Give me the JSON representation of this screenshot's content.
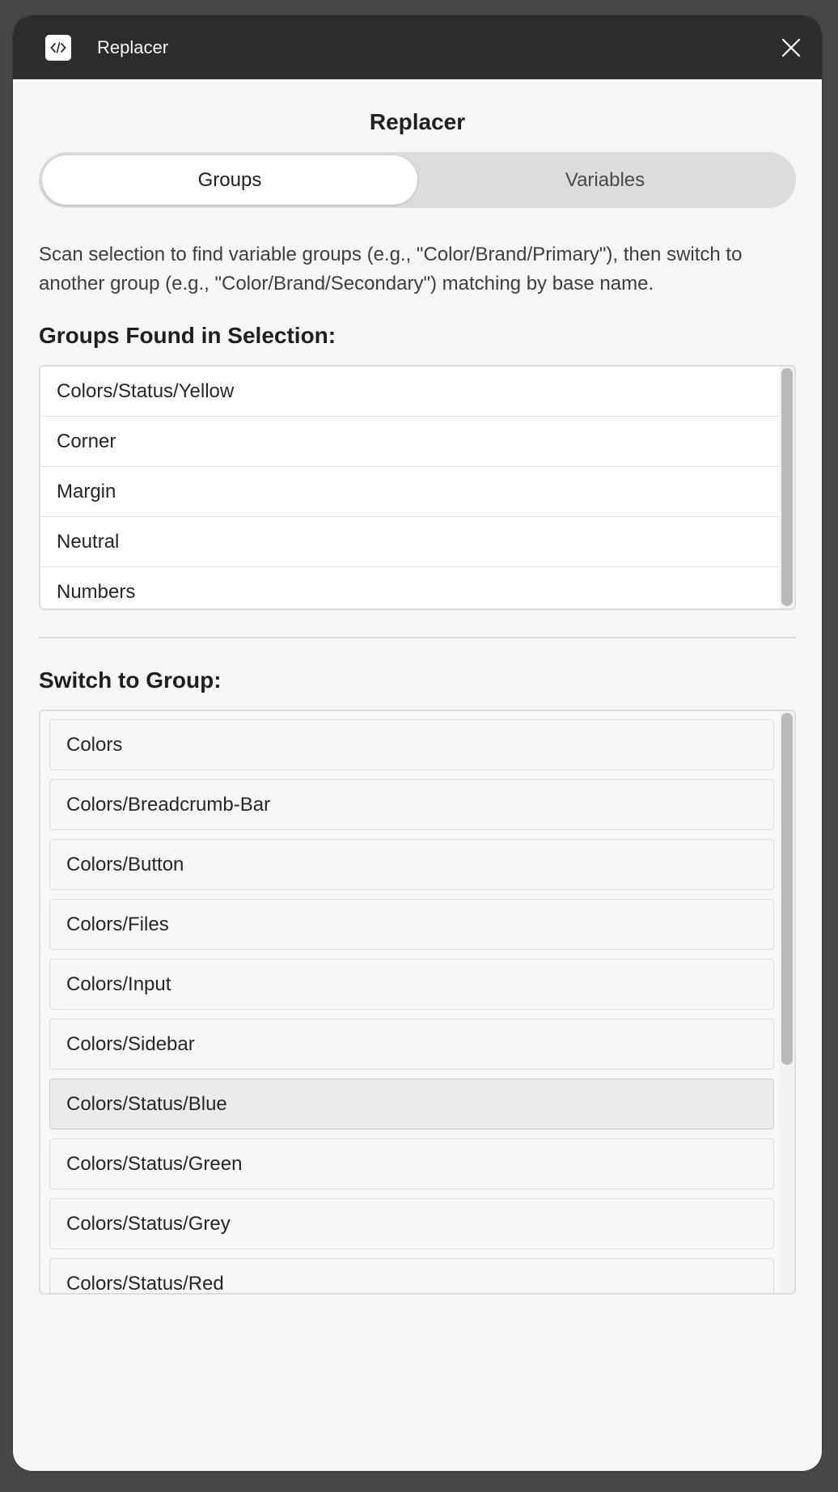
{
  "titlebar": {
    "plugin_icon": "code-brackets-icon",
    "title": "Replacer",
    "close_icon": "close-icon"
  },
  "heading": "Replacer",
  "tabs": [
    {
      "label": "Groups",
      "active": true
    },
    {
      "label": "Variables",
      "active": false
    }
  ],
  "description": "Scan selection to find variable groups (e.g., \"Color/Brand/Primary\"), then switch to another group (e.g., \"Color/Brand/Secondary\") matching by base name.",
  "groups_found": {
    "title": "Groups Found in Selection:",
    "items": [
      "Colors/Status/Yellow",
      "Corner",
      "Margin",
      "Neutral",
      "Numbers"
    ]
  },
  "switch_to": {
    "title": "Switch to Group:",
    "items": [
      "Colors",
      "Colors/Breadcrumb-Bar",
      "Colors/Button",
      "Colors/Files",
      "Colors/Input",
      "Colors/Sidebar",
      "Colors/Status/Blue",
      "Colors/Status/Green",
      "Colors/Status/Grey",
      "Colors/Status/Red"
    ],
    "hovered_item": "Colors/Status/Blue"
  },
  "colors": {
    "titlebar_bg": "#2c2c2c",
    "panel_bg": "#f6f6f6",
    "segment_active_bg": "#ffffff",
    "segment_track_bg": "#dcdcdc"
  }
}
